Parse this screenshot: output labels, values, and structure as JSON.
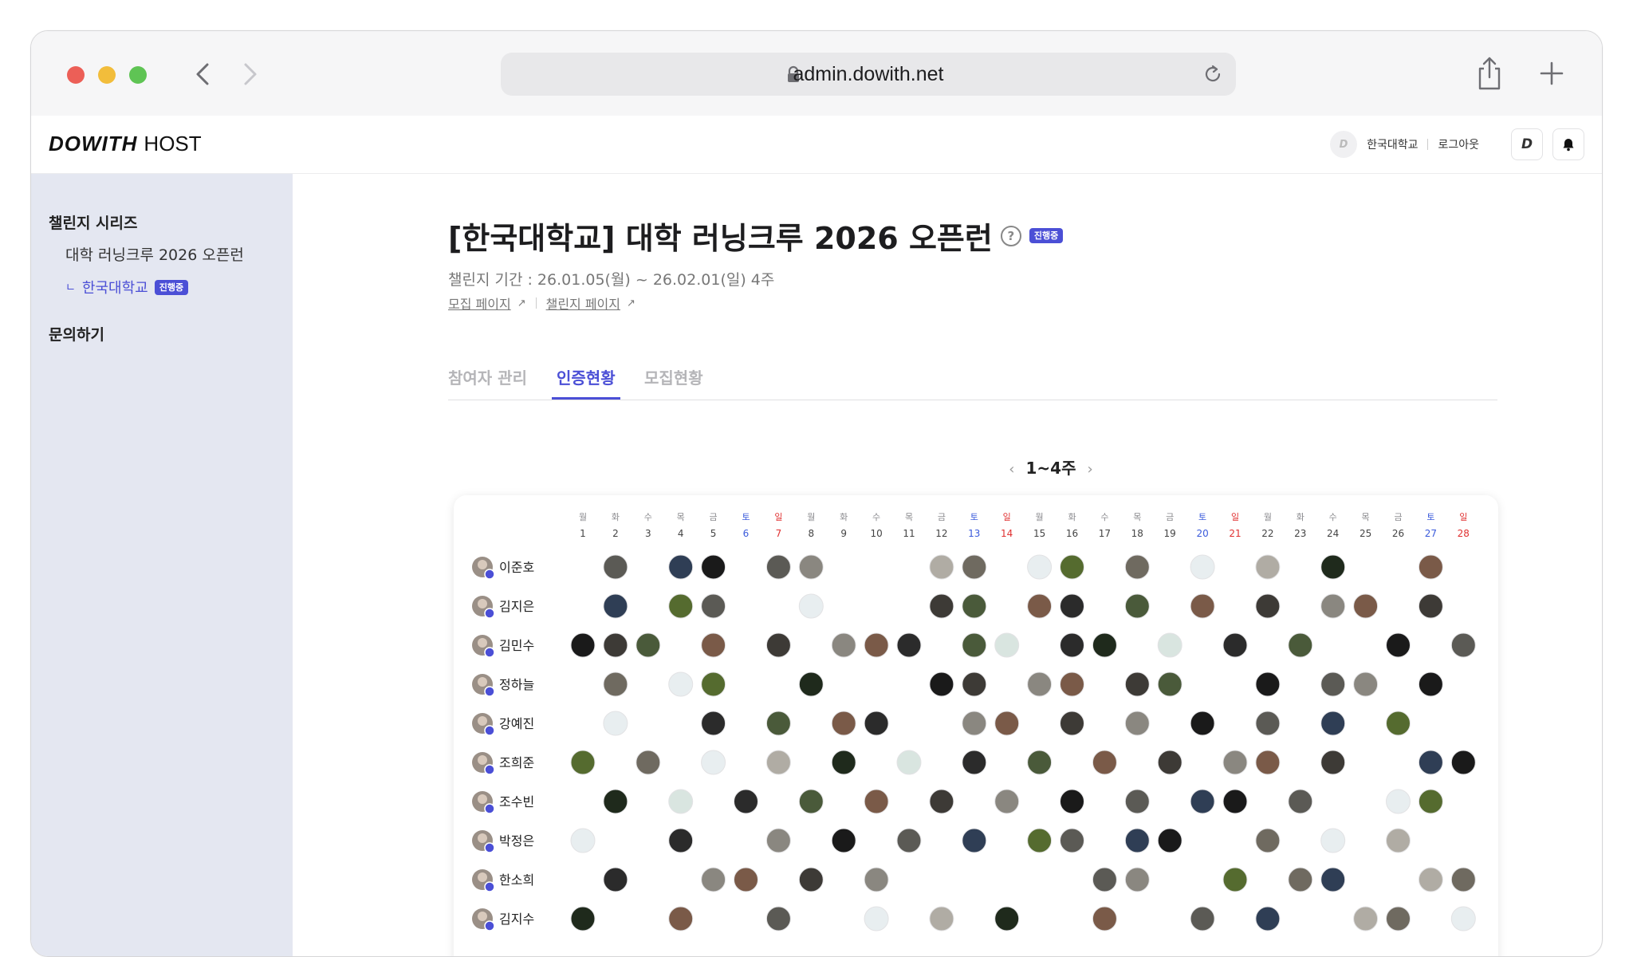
{
  "browser": {
    "url": "admin.dowith.net",
    "icons": [
      "back-icon",
      "forward-icon",
      "lock-icon",
      "reload-icon",
      "share-icon",
      "new-tab-icon"
    ]
  },
  "header": {
    "logo_bold": "DOWITH",
    "logo_light": "HOST",
    "avatar_letter": "D",
    "org_name": "한국대학교",
    "logout": "로그아웃",
    "brand_button": "D",
    "icons": [
      "notification-bell-icon"
    ]
  },
  "sidebar": {
    "section1": "챌린지 시리즈",
    "item": "대학 러닝크루 2026 오픈런",
    "sub_prefix": "ㄴ",
    "sub_item": "한국대학교",
    "sub_badge": "진행중",
    "section2": "문의하기"
  },
  "main": {
    "title": "[한국대학교] 대학 러닝크루 2026 오픈런",
    "help": "?",
    "status_badge": "진행중",
    "period": "챌린지 기간 : 26.01.05(월) ~ 26.02.01(일) 4주",
    "link_recruit": "모집 페이지",
    "link_challenge": "챌린지 페이지",
    "tabs": [
      "참여자 관리",
      "인증현황",
      "모집현황"
    ],
    "active_tab": 1,
    "week_label": "1~4주",
    "colors": {
      "accent": "#4b4fd6",
      "sat": "#3b5bdb",
      "sun": "#e03131"
    }
  },
  "calendar": {
    "days": [
      {
        "dow": "월",
        "d": "1"
      },
      {
        "dow": "화",
        "d": "2"
      },
      {
        "dow": "수",
        "d": "3"
      },
      {
        "dow": "목",
        "d": "4"
      },
      {
        "dow": "금",
        "d": "5"
      },
      {
        "dow": "토",
        "d": "6"
      },
      {
        "dow": "일",
        "d": "7"
      },
      {
        "dow": "월",
        "d": "8"
      },
      {
        "dow": "화",
        "d": "9"
      },
      {
        "dow": "수",
        "d": "10"
      },
      {
        "dow": "목",
        "d": "11"
      },
      {
        "dow": "금",
        "d": "12"
      },
      {
        "dow": "토",
        "d": "13"
      },
      {
        "dow": "일",
        "d": "14"
      },
      {
        "dow": "월",
        "d": "15"
      },
      {
        "dow": "화",
        "d": "16"
      },
      {
        "dow": "수",
        "d": "17"
      },
      {
        "dow": "목",
        "d": "18"
      },
      {
        "dow": "금",
        "d": "19"
      },
      {
        "dow": "토",
        "d": "20"
      },
      {
        "dow": "일",
        "d": "21"
      },
      {
        "dow": "월",
        "d": "22"
      },
      {
        "dow": "화",
        "d": "23"
      },
      {
        "dow": "수",
        "d": "24"
      },
      {
        "dow": "목",
        "d": "25"
      },
      {
        "dow": "금",
        "d": "26"
      },
      {
        "dow": "토",
        "d": "27"
      },
      {
        "dow": "일",
        "d": "28"
      }
    ],
    "participants": [
      {
        "name": "이준호",
        "certs": [
          2,
          4,
          5,
          7,
          8,
          12,
          13,
          15,
          16,
          18,
          20,
          22,
          24,
          27
        ]
      },
      {
        "name": "김지은",
        "certs": [
          2,
          4,
          5,
          8,
          12,
          13,
          15,
          16,
          18,
          20,
          22,
          24,
          25,
          27
        ]
      },
      {
        "name": "김민수",
        "certs": [
          1,
          2,
          3,
          5,
          7,
          9,
          10,
          11,
          13,
          14,
          16,
          17,
          19,
          21,
          23,
          26,
          28
        ]
      },
      {
        "name": "정하늘",
        "certs": [
          2,
          4,
          5,
          8,
          12,
          13,
          15,
          16,
          18,
          19,
          22,
          24,
          25,
          27
        ]
      },
      {
        "name": "강예진",
        "certs": [
          2,
          5,
          7,
          9,
          10,
          13,
          14,
          16,
          18,
          20,
          22,
          24,
          26
        ]
      },
      {
        "name": "조희준",
        "certs": [
          1,
          3,
          5,
          7,
          9,
          11,
          13,
          15,
          17,
          19,
          21,
          22,
          24,
          27,
          28
        ]
      },
      {
        "name": "조수빈",
        "certs": [
          2,
          4,
          6,
          8,
          10,
          12,
          14,
          16,
          18,
          20,
          21,
          23,
          26,
          27
        ]
      },
      {
        "name": "박정은",
        "certs": [
          1,
          4,
          7,
          9,
          11,
          13,
          15,
          16,
          18,
          19,
          22,
          24,
          26
        ]
      },
      {
        "name": "한소희",
        "certs": [
          2,
          5,
          6,
          8,
          10,
          17,
          18,
          21,
          23,
          24,
          27,
          28
        ]
      },
      {
        "name": "김지수",
        "certs": [
          1,
          4,
          7,
          10,
          12,
          14,
          17,
          20,
          22,
          25,
          26,
          28
        ]
      }
    ]
  }
}
